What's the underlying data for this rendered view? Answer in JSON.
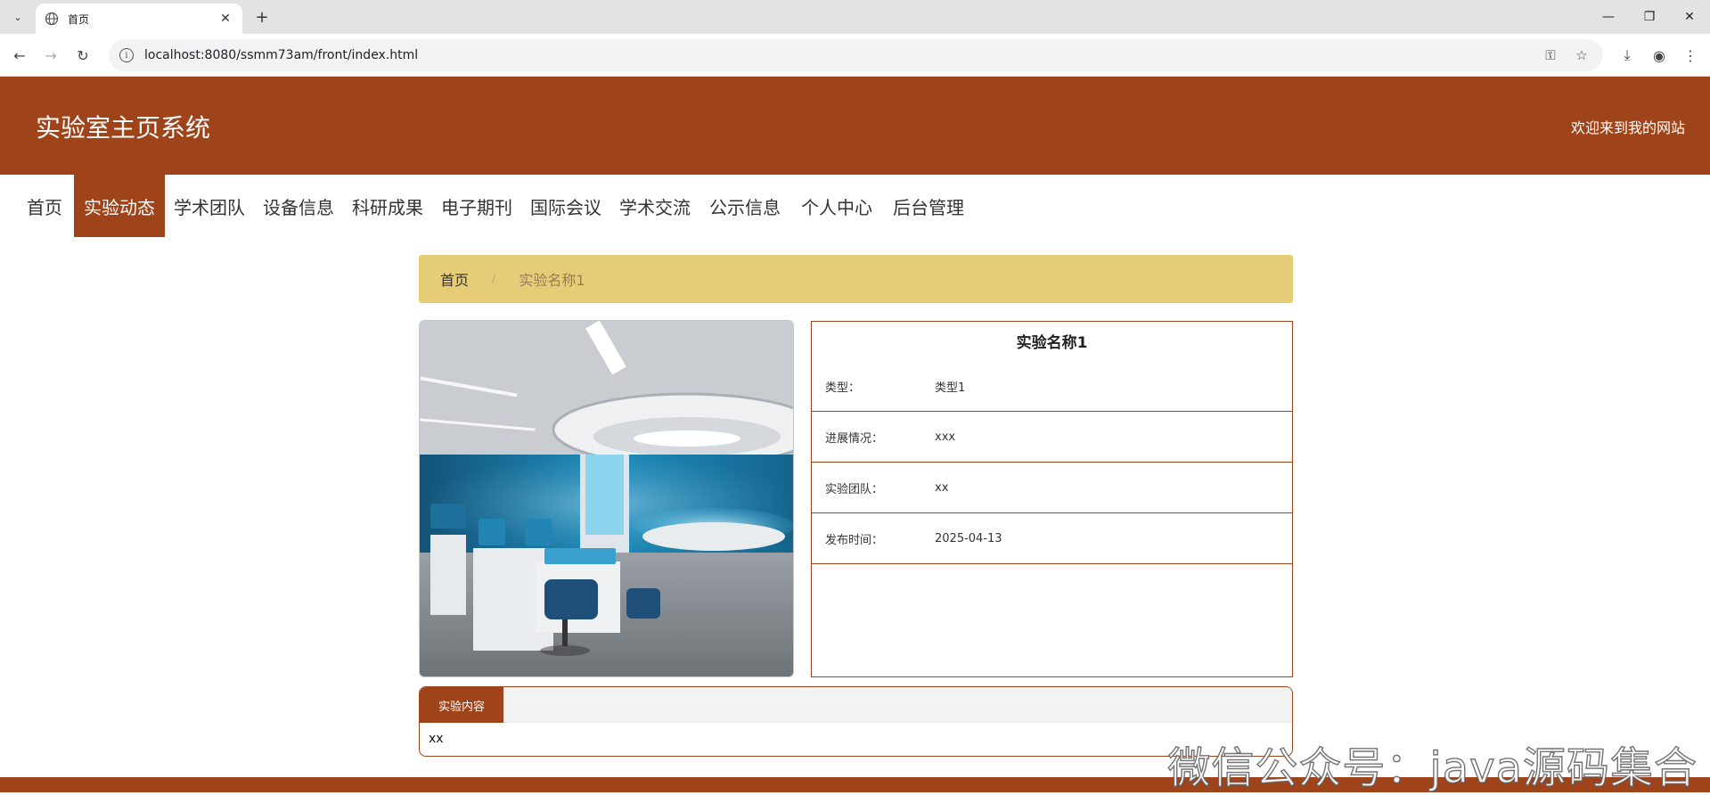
{
  "browser": {
    "tab_title": "首页",
    "url": "localhost:8080/ssmm73am/front/index.html"
  },
  "header": {
    "site_title": "实验室主页系统",
    "welcome": "欢迎来到我的网站"
  },
  "nav": {
    "items": [
      "首页",
      "实验动态",
      "学术团队",
      "设备信息",
      "科研成果",
      "电子期刊",
      "国际会议",
      "学术交流",
      "公示信息",
      "个人中心",
      "后台管理"
    ],
    "active": "实验动态"
  },
  "breadcrumb": {
    "home": "首页",
    "separator": "/",
    "current": "实验名称1"
  },
  "detail": {
    "title": "实验名称1",
    "rows": [
      {
        "label": "类型：",
        "value": "类型1"
      },
      {
        "label": "进展情况：",
        "value": "xxx"
      },
      {
        "label": "实验团队：",
        "value": "xx"
      },
      {
        "label": "发布时间：",
        "value": "2025-04-13"
      }
    ]
  },
  "content": {
    "tab_label": "实验内容",
    "body": "xx"
  },
  "watermark": "微信公众号：java源码集合",
  "colors": {
    "brand": "#9f441a",
    "breadcrumb_bg": "#e7cc78"
  },
  "icons": [
    "tab-list-icon",
    "globe-icon",
    "close-icon",
    "plus-icon",
    "minimize-icon",
    "restore-icon",
    "back-icon",
    "forward-icon",
    "reload-icon",
    "site-info-icon",
    "key-icon",
    "star-icon",
    "download-icon",
    "profile-icon",
    "menu-icon"
  ]
}
